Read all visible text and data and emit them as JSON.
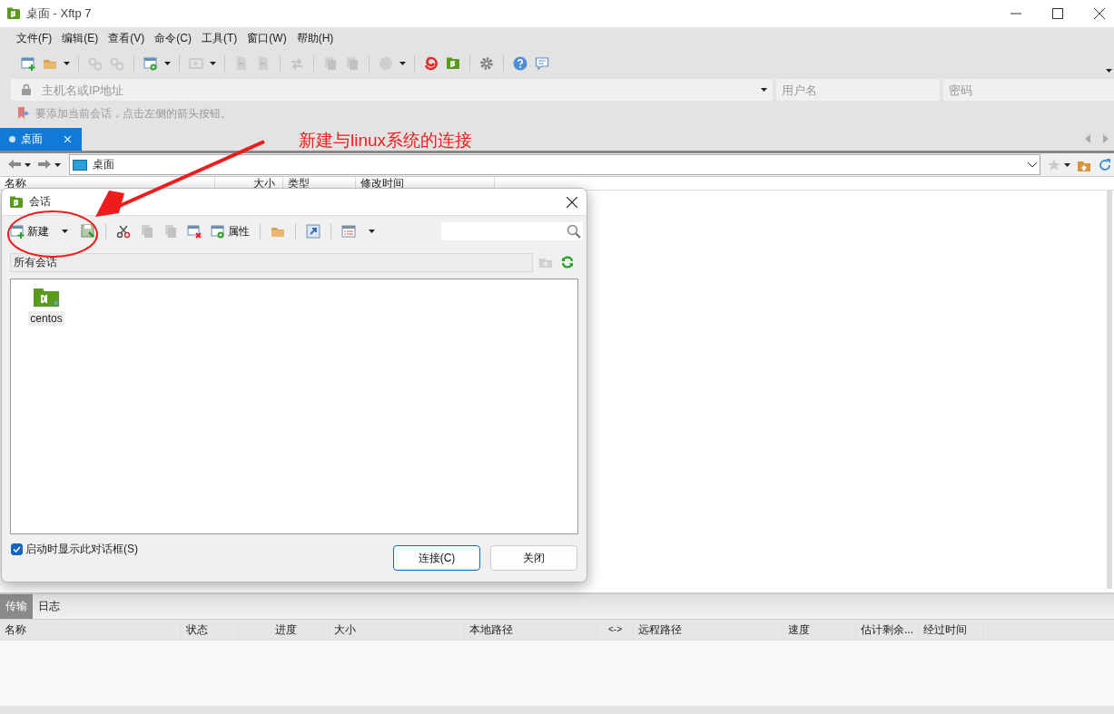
{
  "window": {
    "title": "桌面 - Xftp 7"
  },
  "menu": [
    "文件(F)",
    "编辑(E)",
    "查看(V)",
    "命令(C)",
    "工具(T)",
    "窗口(W)",
    "帮助(H)"
  ],
  "connection_bar": {
    "host_placeholder": "主机名或IP地址",
    "username_placeholder": "用户名",
    "password_placeholder": "密码"
  },
  "hint": "要添加当前会话，点击左侧的箭头按钮。",
  "tabs": [
    {
      "label": "桌面",
      "selected": true
    }
  ],
  "path": "桌面",
  "file_list": {
    "columns": [
      "名称",
      "大小",
      "类型",
      "修改时间"
    ]
  },
  "session_dialog": {
    "title": "会话",
    "new_label": "新建",
    "properties_label": "属性",
    "folder": "所有会话",
    "sessions": [
      {
        "name": "centos"
      }
    ],
    "show_on_startup": {
      "label": "启动时显示此对话框(S)",
      "checked": true
    },
    "buttons": [
      {
        "label": "连接(C)",
        "default": true
      },
      {
        "label": "关闭",
        "default": false
      }
    ]
  },
  "bottom_tabs": [
    {
      "label": "传输",
      "selected": true
    },
    {
      "label": "日志",
      "selected": false
    }
  ],
  "transfers": {
    "columns": [
      "名称",
      "状态",
      "进度",
      "大小",
      "本地路径",
      "<->",
      "远程路径",
      "速度",
      "估计剩余...",
      "经过时间"
    ]
  },
  "annotation": {
    "text": "新建与linux系统的连接"
  }
}
